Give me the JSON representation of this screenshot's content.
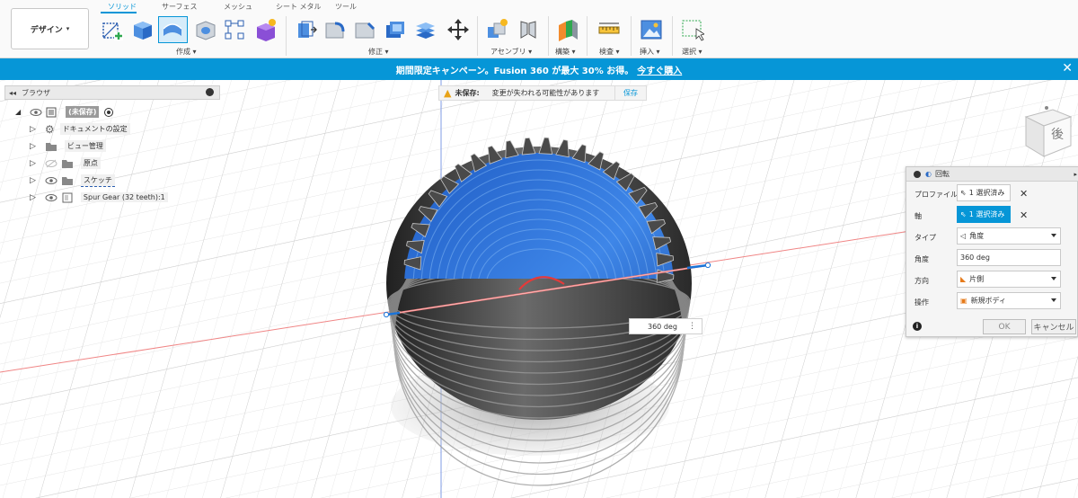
{
  "toolbar": {
    "workspace": "デザイン",
    "tabs": [
      "ソリッド",
      "サーフェス",
      "メッシュ",
      "シート メタル",
      "ツール"
    ],
    "groups": [
      "作成",
      "修正",
      "アセンブリ",
      "構築",
      "検査",
      "挿入",
      "選択"
    ]
  },
  "banner": {
    "text": "期間限定キャンペーン。Fusion 360 が最大 30% お得。",
    "link": "今すぐ購入"
  },
  "browser": {
    "title": "ブラウザ",
    "root": "(未保存)",
    "items": [
      "ドキュメントの設定",
      "ビュー管理",
      "原点",
      "スケッチ",
      "Spur Gear (32 teeth):1"
    ]
  },
  "unsaved": {
    "label": "未保存:",
    "message": "変更が失われる可能性があります",
    "save": "保存"
  },
  "viewcube": {
    "face": "後"
  },
  "dialog": {
    "title": "回転",
    "rows": [
      {
        "label": "プロファイル",
        "value": "1 選択済み"
      },
      {
        "label": "軸",
        "value": "1 選択済み"
      },
      {
        "label": "タイプ",
        "value": "角度"
      },
      {
        "label": "角度",
        "value": "360 deg"
      },
      {
        "label": "方向",
        "value": "片側"
      },
      {
        "label": "操作",
        "value": "新規ボディ"
      }
    ],
    "ok": "OK",
    "cancel": "キャンセル"
  },
  "angle_input": "360 deg",
  "colors": {
    "accent": "#0696d7",
    "gear_blue": "#2d6fd0",
    "gear_dark": "#3a3a3a"
  }
}
